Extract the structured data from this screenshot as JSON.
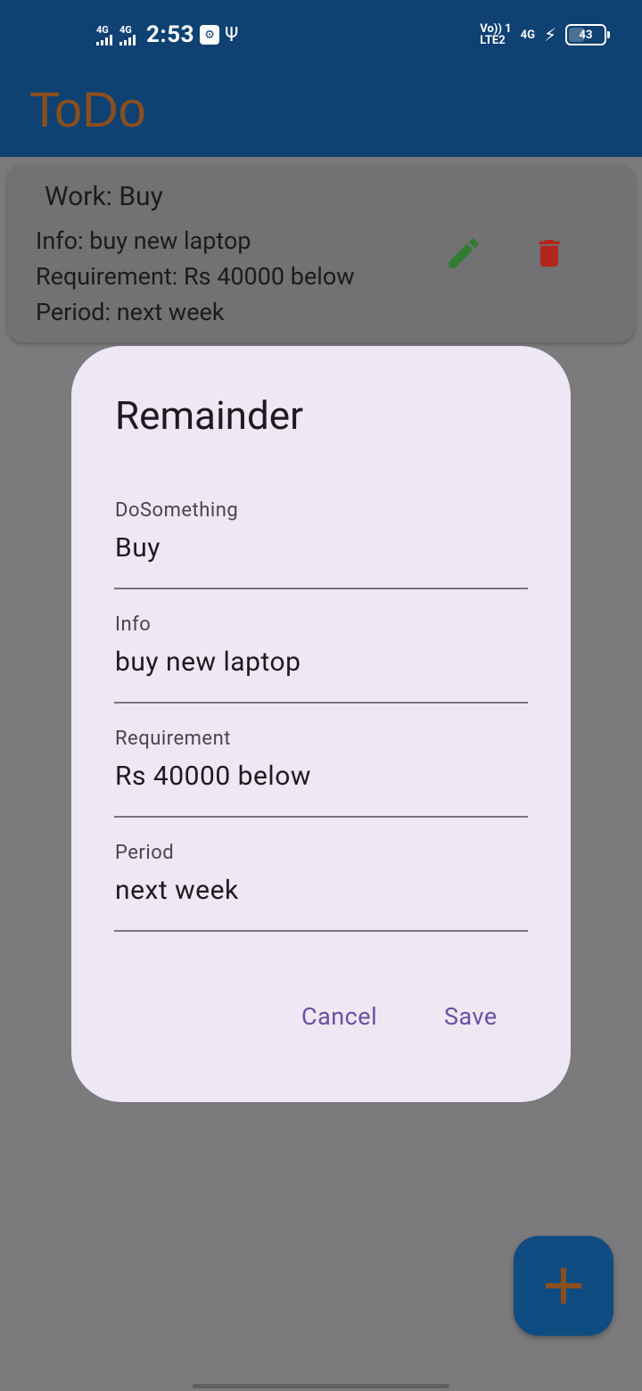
{
  "status_bar": {
    "sim1_label": "4G",
    "sim2_label": "4G",
    "time": "2:53",
    "volte_line1": "Vo)) 1",
    "volte_line2": "LTE2",
    "network": "4G",
    "battery": "43"
  },
  "app_bar": {
    "title": "ToDo"
  },
  "task_card": {
    "title": "Work: Buy",
    "info": "Info: buy new laptop",
    "requirement": "Requirement: Rs 40000 below",
    "period": "Period: next week"
  },
  "dialog": {
    "title": "Remainder",
    "fields": [
      {
        "label": "DoSomething",
        "value": "Buy"
      },
      {
        "label": "Info",
        "value": "buy new laptop"
      },
      {
        "label": "Requirement",
        "value": "Rs 40000 below"
      },
      {
        "label": "Period",
        "value": "next week"
      }
    ],
    "cancel_label": "Cancel",
    "save_label": "Save"
  },
  "colors": {
    "app_bar": "#0f4173",
    "title_text": "#8a4f1e",
    "scrim": "#7b7a7d",
    "dialog_bg": "#eee8f4",
    "dialog_button_text": "#6750a4",
    "edit_icon": "#2e7d32",
    "delete_icon": "#b3261e",
    "fab": "#0f4c82",
    "fab_icon": "#8a4f1e"
  },
  "icons": {
    "edit": "pencil-icon",
    "delete": "trash-icon",
    "fab": "plus-icon"
  }
}
